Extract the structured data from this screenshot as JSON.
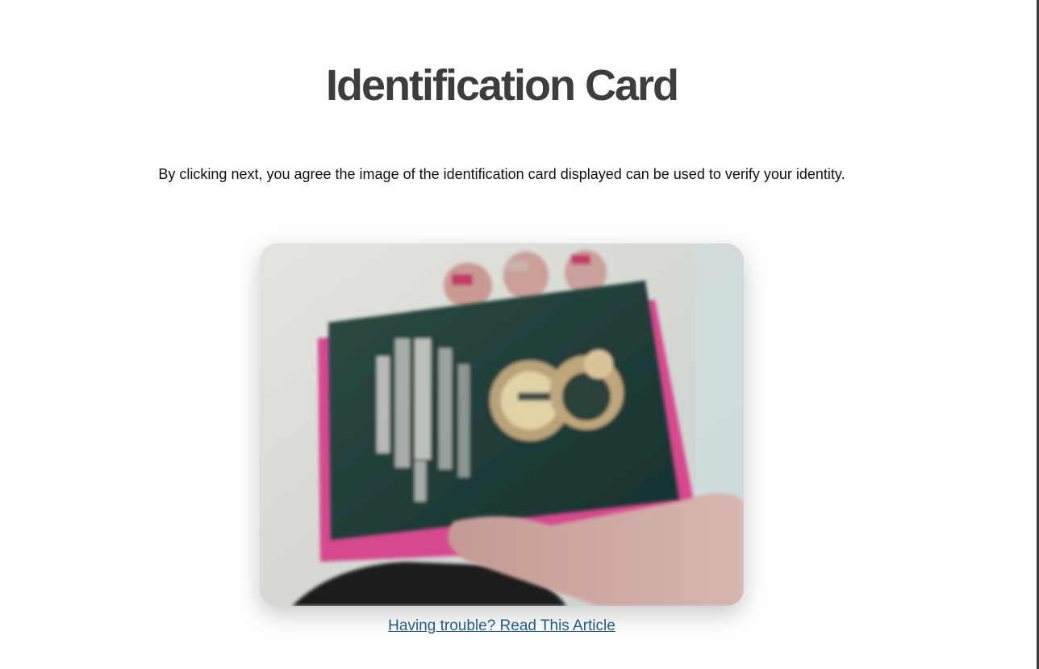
{
  "page": {
    "title": "Identification Card",
    "consent_text": "By clicking next, you agree the image of the identification card displayed can be used to verify your identity.",
    "help_link_label": "Having trouble? Read This Article"
  },
  "colors": {
    "title": "#3d3d3d",
    "link": "#1e5a8c",
    "card_cover": "#1f3b37",
    "card_edge": "#d64a8f"
  },
  "photo": {
    "description_icon": "id-card-photo"
  }
}
